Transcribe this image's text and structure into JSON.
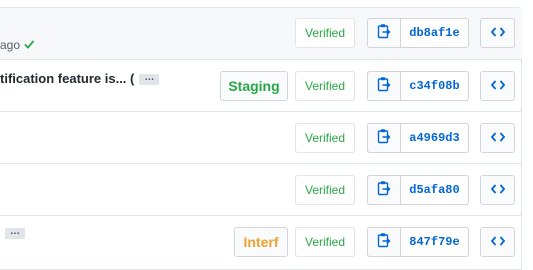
{
  "commits": [
    {
      "message_tail": "",
      "meta": "ago",
      "has_check": true,
      "has_ellipsis": false,
      "tag": "",
      "tag_style": "",
      "verified": "Verified",
      "sha": "db8af1e"
    },
    {
      "message_tail": "tification feature is... (",
      "meta": "",
      "has_check": false,
      "has_ellipsis": true,
      "tag": "Staging",
      "tag_style": "staging",
      "verified": "Verified",
      "sha": "c34f08b"
    },
    {
      "message_tail": "",
      "meta": "",
      "has_check": false,
      "has_ellipsis": false,
      "tag": "",
      "tag_style": "",
      "verified": "Verified",
      "sha": "a4969d3"
    },
    {
      "message_tail": "",
      "meta": "",
      "has_check": false,
      "has_ellipsis": false,
      "tag": "",
      "tag_style": "",
      "verified": "Verified",
      "sha": "d5afa80"
    },
    {
      "message_tail": "",
      "meta": "",
      "has_check": false,
      "has_ellipsis": true,
      "tag": "Interf",
      "tag_style": "interf",
      "verified": "Verified",
      "sha": "847f79e"
    }
  ],
  "icons": {
    "copy": "clipboard-icon",
    "browse": "code-icon",
    "check": "check-icon"
  },
  "colors": {
    "verified": "#28a745",
    "staging": "#28a745",
    "interf": "#f0a030",
    "link": "#0366d6"
  }
}
